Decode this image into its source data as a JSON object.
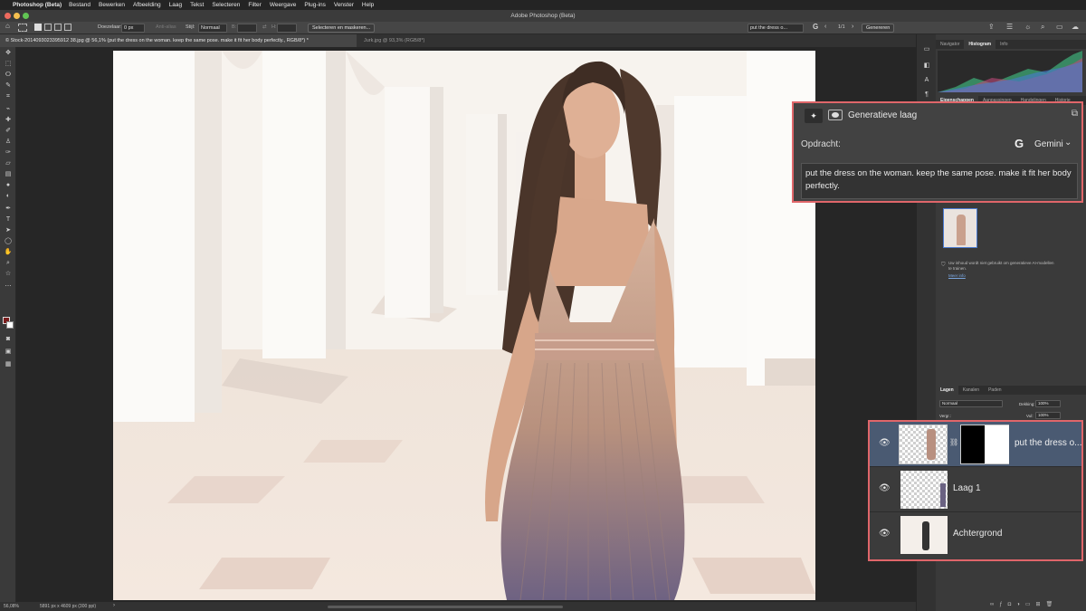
{
  "menubar": {
    "app": "Photoshop (Beta)",
    "items": [
      "Bestand",
      "Bewerken",
      "Afbeelding",
      "Laag",
      "Tekst",
      "Selecteren",
      "Filter",
      "Weergave",
      "Plug-ins",
      "Venster",
      "Help"
    ]
  },
  "window": {
    "title": "Adobe Photoshop (Beta)"
  },
  "options": {
    "feather_label": "Doezelaar:",
    "feather_value": "0 px",
    "antialias": "Anti-alias",
    "style_label": "Stijl:",
    "style_value": "Normaal",
    "width_label": "B:",
    "height_label": "H:",
    "select_mask": "Selecteren en maskeren...",
    "search_value": "put the dress o...",
    "page_counter": "1/1",
    "generate": "Genereren"
  },
  "tabs": [
    {
      "label": "© Stock-2014093023395912 38.jpg @ 56,1% (put the dress on the woman. keep the same pose. make it fit her body perfectly., RGB/8*) *"
    },
    {
      "label": "Jurk.jpg @ 93,3% (RGB/8*)"
    }
  ],
  "status": {
    "zoom": "56,08%",
    "info": "5891 px x 4609 px (300 ppi)"
  },
  "right_panel": {
    "top_tabs": [
      "Navigator",
      "Histogram",
      "Info"
    ],
    "active_top": "Histogram",
    "mid_tabs": [
      "Eigenschappen",
      "Aanpassingen",
      "Handelingen",
      "Historie"
    ],
    "notice": "Uw inhoud wordt niet gebruikt om generatieve AI-modellen te trainen.",
    "notice_link": "Meer info",
    "layer_tabs": [
      "Lagen",
      "Kanalen",
      "Paden"
    ],
    "blend_mode": "Normaal",
    "opacity_label": "Dekking:",
    "opacity_value": "100%",
    "lock_label": "Vergr.:",
    "fill_label": "Vul:",
    "fill_value": "100%"
  },
  "gen_panel": {
    "title": "Generatieve laag",
    "prompt_label": "Opdracht:",
    "model": "Gemini",
    "prompt": "put the dress on the woman. keep the same pose. make it fit her body perfectly."
  },
  "layers": [
    {
      "name": "put the dress o...",
      "selected": true
    },
    {
      "name": "Laag 1",
      "selected": false
    },
    {
      "name": "Achtergrond",
      "selected": false
    }
  ],
  "colors": {
    "highlight": "#e0666a",
    "selected_layer": "#4a5a72",
    "panel": "#3a3a3a"
  }
}
